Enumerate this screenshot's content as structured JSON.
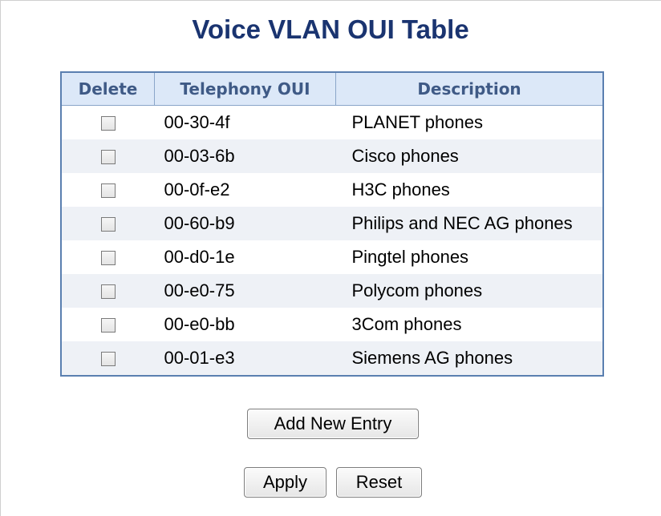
{
  "page": {
    "title": "Voice VLAN OUI Table"
  },
  "table": {
    "headers": {
      "delete": "Delete",
      "oui": "Telephony OUI",
      "description": "Description"
    },
    "rows": [
      {
        "oui": "00-30-4f",
        "description": "PLANET phones",
        "delete_checked": false
      },
      {
        "oui": "00-03-6b",
        "description": "Cisco phones",
        "delete_checked": false
      },
      {
        "oui": "00-0f-e2",
        "description": "H3C phones",
        "delete_checked": false
      },
      {
        "oui": "00-60-b9",
        "description": "Philips and NEC AG phones",
        "delete_checked": false
      },
      {
        "oui": "00-d0-1e",
        "description": "Pingtel phones",
        "delete_checked": false
      },
      {
        "oui": "00-e0-75",
        "description": "Polycom phones",
        "delete_checked": false
      },
      {
        "oui": "00-e0-bb",
        "description": "3Com phones",
        "delete_checked": false
      },
      {
        "oui": "00-01-e3",
        "description": "Siemens AG phones",
        "delete_checked": false
      }
    ]
  },
  "buttons": {
    "add_new_entry": "Add New Entry",
    "apply": "Apply",
    "reset": "Reset"
  },
  "colors": {
    "title": "#1a3470",
    "header_bg": "#dce8f8",
    "table_border": "#5a7fb0",
    "row_alt_bg": "#eef1f6"
  }
}
